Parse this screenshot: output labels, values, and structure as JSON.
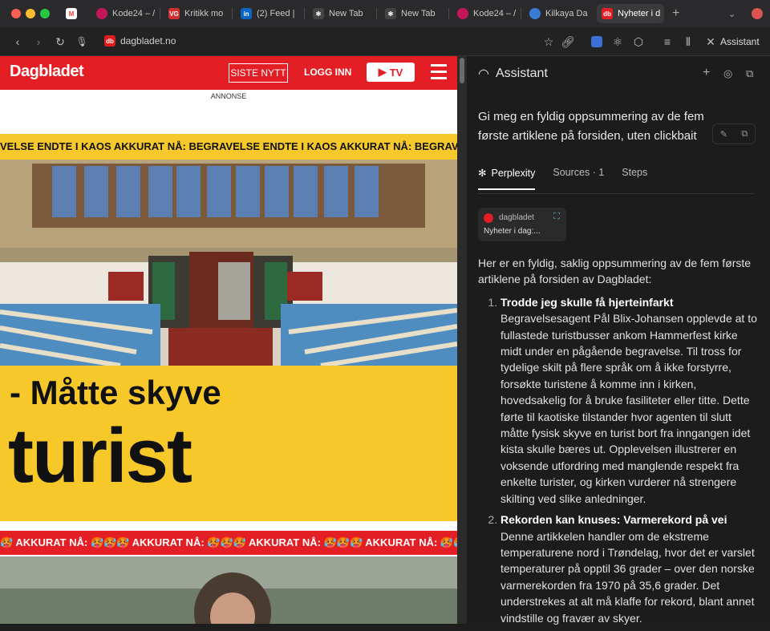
{
  "tabs": [
    {
      "label": "",
      "icon": "gmail-icon",
      "color": "#ea4335"
    },
    {
      "label": "Kode24 – /",
      "icon": "kode24-icon",
      "color": "#c2185b"
    },
    {
      "label": "Kritikk mo",
      "icon": "vg-icon",
      "color": "#d32f2f"
    },
    {
      "label": "(2) Feed |",
      "icon": "linkedin-icon",
      "color": "#0a66c2"
    },
    {
      "label": "New Tab",
      "icon": "perplexity-icon",
      "color": "#444"
    },
    {
      "label": "New Tab",
      "icon": "perplexity-icon",
      "color": "#444"
    },
    {
      "label": "Kode24 – /",
      "icon": "kode24-icon",
      "color": "#c2185b"
    },
    {
      "label": "Kilkaya Da",
      "icon": "kilkaya-icon",
      "color": "#3a7bd5"
    },
    {
      "label": "Nyheter i d",
      "icon": "db-icon",
      "color": "#e31e24"
    }
  ],
  "toolbar": {
    "url": "dagbladet.no",
    "assistant_label": "Assistant"
  },
  "site": {
    "logo": "Dagbladet",
    "siste_nytt": "SISTE NYTT",
    "logg_inn": "LOGG INN",
    "tv": "TV",
    "annonse": "ANNONSE",
    "ticker": "VELSE ENDTE I KAOS   AKKURAT NÅ: BEGRAVELSE ENDTE I KAOS   AKKURAT NÅ: BEGRAV",
    "headline_small": "- Måtte skyve",
    "headline_big": "turist",
    "ticker2": "🥵   AKKURAT NÅ: 🥵🥵🥵   AKKURAT NÅ: 🥵🥵🥵   AKKURAT NÅ: 🥵🥵🥵   AKKURAT NÅ: 🥵🥵🥵"
  },
  "assistant": {
    "title": "Assistant",
    "query_line1": "Gi meg en fyldig oppsummering av de fem",
    "query_line2": "første artiklene på forsiden, uten clickbait",
    "tab_perplexity": "Perplexity",
    "tab_sources": "Sources · 1",
    "tab_steps": "Steps",
    "source_name": "dagbladet",
    "source_title": "Nyheter i dag:...",
    "intro": "Her er en fyldig, saklig oppsummering av de fem første artiklene på forsiden av Dagbladet:",
    "items": [
      {
        "title": "Trodde jeg skulle få hjerteinfarkt",
        "text": "Begravelsesagent Pål Blix-Johansen opplevde at to fullastede turistbusser ankom Hammerfest kirke midt under en pågående begravelse. Til tross for tydelige skilt på flere språk om å ikke forstyrre, forsøkte turistene å komme inn i kirken, hovedsakelig for å bruke fasiliteter eller titte. Dette førte til kaotiske tilstander hvor agenten til slutt måtte fysisk skyve en turist bort fra inngangen idet kista skulle bæres ut. Opplevelsen illustrerer en voksende utfordring med manglende respekt fra enkelte turister, og kirken vurderer nå strengere skilting ved slike anledninger."
      },
      {
        "title": "Rekorden kan knuses: Varmerekord på vei",
        "text": "Denne artikkelen handler om de ekstreme temperaturene nord i Trøndelag, hvor det er varslet temperaturer på opptil 36 grader – over den norske varmerekorden fra 1970 på 35,6 grader. Det understrekes at alt må klaffe for rekord, blant annet vindstille og fravær av skyer."
      }
    ]
  }
}
